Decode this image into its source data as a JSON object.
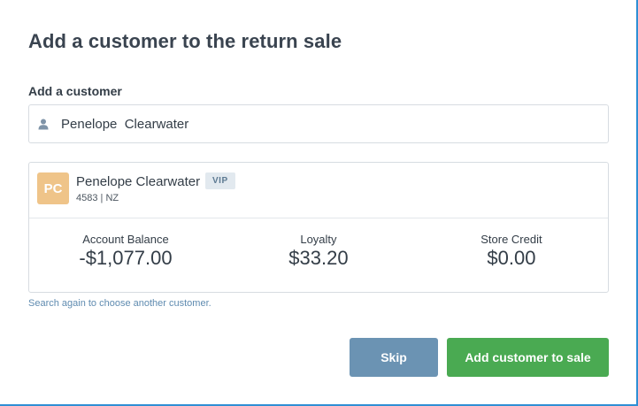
{
  "dialog": {
    "title": "Add a customer to the return sale"
  },
  "search": {
    "label": "Add a customer",
    "value": "Penelope  Clearwater",
    "icon": "person-icon"
  },
  "customer": {
    "initials": "PC",
    "avatar_color": "#efc489",
    "name": "Penelope Clearwater",
    "badge": "VIP",
    "meta": "4583 | NZ",
    "stats": [
      {
        "label": "Account Balance",
        "value": "-$1,077.00"
      },
      {
        "label": "Loyalty",
        "value": "$33.20"
      },
      {
        "label": "Store Credit",
        "value": "$0.00"
      }
    ]
  },
  "hint": "Search again to choose another customer.",
  "actions": {
    "skip_label": "Skip",
    "skip_color": "#6b93b3",
    "add_label": "Add customer to sale",
    "add_color": "#4aaa52"
  }
}
